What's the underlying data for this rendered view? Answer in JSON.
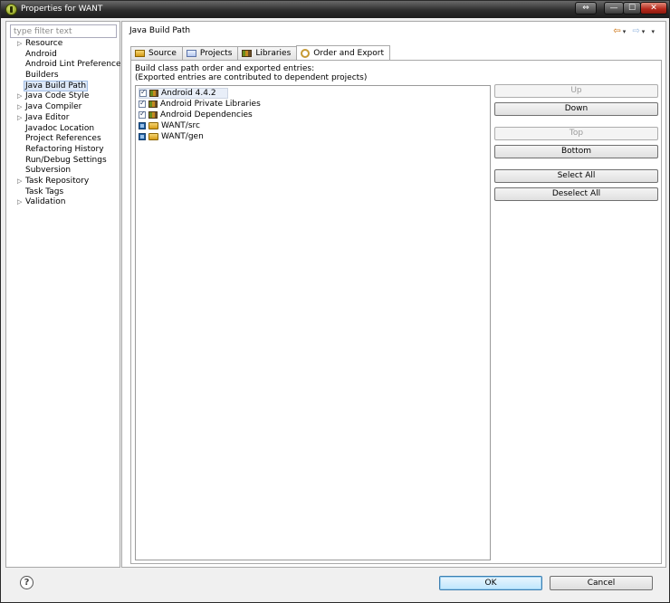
{
  "window": {
    "title": "Properties for WANT"
  },
  "system_buttons": {
    "extra": "⇔",
    "minimize": "—",
    "maximize": "☐",
    "close": "✕"
  },
  "filter": {
    "placeholder": "type filter text"
  },
  "tree": [
    {
      "label": "Resource",
      "expandable": true
    },
    {
      "label": "Android",
      "expandable": false
    },
    {
      "label": "Android Lint Preferences",
      "expandable": false
    },
    {
      "label": "Builders",
      "expandable": false
    },
    {
      "label": "Java Build Path",
      "expandable": false,
      "selected": true
    },
    {
      "label": "Java Code Style",
      "expandable": true
    },
    {
      "label": "Java Compiler",
      "expandable": true
    },
    {
      "label": "Java Editor",
      "expandable": true
    },
    {
      "label": "Javadoc Location",
      "expandable": false
    },
    {
      "label": "Project References",
      "expandable": false
    },
    {
      "label": "Refactoring History",
      "expandable": false
    },
    {
      "label": "Run/Debug Settings",
      "expandable": false
    },
    {
      "label": "Subversion",
      "expandable": false
    },
    {
      "label": "Task Repository",
      "expandable": true
    },
    {
      "label": "Task Tags",
      "expandable": false
    },
    {
      "label": "Validation",
      "expandable": true
    }
  ],
  "page": {
    "title": "Java Build Path",
    "nav": {
      "back": "⇦",
      "forward": "⇨",
      "menu": "▾"
    }
  },
  "tabs": [
    {
      "label": "Source",
      "icon": "source-folder-icon"
    },
    {
      "label": "Projects",
      "icon": "project-icon"
    },
    {
      "label": "Libraries",
      "icon": "library-icon"
    },
    {
      "label": "Order and Export",
      "icon": "order-export-icon",
      "active": true
    }
  ],
  "order_export": {
    "description_line1": "Build class path order and exported entries:",
    "description_line2": "(Exported entries are contributed to dependent projects)",
    "entries": [
      {
        "label": "Android 4.4.2",
        "state": "checked",
        "icon": "library-icon",
        "selected": true
      },
      {
        "label": "Android Private Libraries",
        "state": "checked",
        "icon": "library-icon"
      },
      {
        "label": "Android Dependencies",
        "state": "checked",
        "icon": "library-icon"
      },
      {
        "label": "WANT/src",
        "state": "filled",
        "icon": "folder-icon"
      },
      {
        "label": "WANT/gen",
        "state": "filled",
        "icon": "folder-icon"
      }
    ],
    "buttons": {
      "up": "Up",
      "down": "Down",
      "top": "Top",
      "bottom": "Bottom",
      "select_all": "Select All",
      "deselect_all": "Deselect All"
    }
  },
  "dialog": {
    "help": "?",
    "ok": "OK",
    "cancel": "Cancel"
  },
  "colors": {
    "titlebar": "#2d2d2d",
    "selection": "#dde8f7",
    "default_button": "#bee6fd"
  }
}
